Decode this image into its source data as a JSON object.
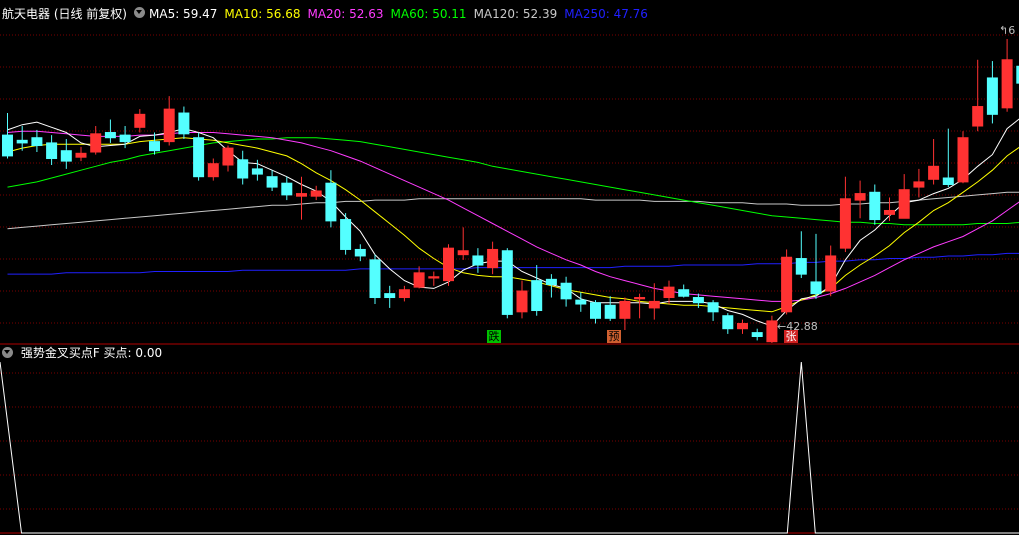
{
  "main_legend": {
    "title": "航天电器 (日线 前复权)",
    "ma5": "MA5: 59.47",
    "ma10": "MA10: 56.68",
    "ma20": "MA20: 52.63",
    "ma60": "MA60: 50.11",
    "ma120": "MA120: 52.39",
    "ma250": "MA250: 47.76"
  },
  "colors": {
    "bg": "#000000",
    "up": "#ff3232",
    "down": "#54ffff",
    "ma5": "#ffffff",
    "ma10": "#ffff00",
    "ma20": "#ff3cff",
    "ma60": "#00ff00",
    "ma120": "#c8c8c8",
    "ma250": "#2020ff",
    "grid": "#7a0000",
    "divider": "#b00000"
  },
  "sub_legend": {
    "title": "强势金叉买点F  买点: 0.00"
  },
  "signals": {
    "die": "跌",
    "yu": "预",
    "zhang": "张"
  },
  "price_labels": {
    "low": "42.88",
    "high_partial": "6"
  },
  "chart_data": {
    "type": "candlestick",
    "title": "航天电器 (日线 前复权)",
    "ylim": [
      40.8,
      67.2
    ],
    "low_marker": 42.88,
    "candles": [
      [
        56.8,
        55.2,
        58.5,
        55.0
      ],
      [
        56.4,
        56.2,
        57.5,
        55.6
      ],
      [
        56.6,
        56.0,
        57.2,
        55.5
      ],
      [
        56.2,
        55.0,
        56.8,
        54.5
      ],
      [
        55.6,
        54.8,
        56.5,
        54.2
      ],
      [
        55.1,
        55.4,
        55.9,
        54.8
      ],
      [
        55.5,
        56.9,
        57.5,
        55.3
      ],
      [
        57.0,
        56.6,
        58.0,
        56.2
      ],
      [
        56.8,
        56.3,
        57.5,
        55.8
      ],
      [
        57.4,
        58.4,
        58.8,
        57.0
      ],
      [
        56.3,
        55.6,
        57.0,
        55.3
      ],
      [
        56.3,
        58.8,
        59.8,
        56.0
      ],
      [
        58.5,
        56.9,
        59.0,
        56.5
      ],
      [
        56.6,
        53.6,
        57.0,
        53.3
      ],
      [
        53.6,
        54.6,
        55.0,
        53.3
      ],
      [
        54.5,
        55.8,
        56.0,
        54.0
      ],
      [
        54.9,
        53.5,
        55.6,
        53.0
      ],
      [
        54.2,
        53.8,
        54.9,
        53.3
      ],
      [
        53.6,
        52.8,
        54.1,
        52.5
      ],
      [
        53.1,
        52.2,
        53.6,
        51.8
      ],
      [
        52.1,
        52.3,
        53.6,
        50.3
      ],
      [
        52.1,
        52.5,
        52.9,
        51.8
      ],
      [
        53.1,
        50.2,
        54.1,
        49.7
      ],
      [
        50.3,
        48.0,
        50.8,
        47.6
      ],
      [
        48.0,
        47.5,
        48.4,
        47.1
      ],
      [
        47.2,
        44.3,
        47.6,
        43.8
      ],
      [
        44.6,
        44.3,
        45.2,
        43.5
      ],
      [
        44.3,
        44.9,
        45.2,
        44.0
      ],
      [
        45.1,
        46.2,
        46.7,
        45.0
      ],
      [
        45.8,
        45.9,
        46.3,
        45.2
      ],
      [
        45.6,
        48.1,
        48.4,
        45.2
      ],
      [
        47.6,
        47.9,
        49.7,
        47.2
      ],
      [
        47.5,
        46.8,
        48.1,
        46.2
      ],
      [
        46.6,
        48.0,
        48.6,
        46.1
      ],
      [
        47.9,
        43.0,
        48.1,
        42.7
      ],
      [
        43.2,
        44.8,
        45.6,
        42.7
      ],
      [
        45.6,
        43.3,
        46.8,
        42.9
      ],
      [
        45.7,
        45.3,
        46.1,
        44.3
      ],
      [
        45.4,
        44.2,
        45.9,
        43.6
      ],
      [
        44.1,
        43.8,
        44.7,
        43.2
      ],
      [
        43.9,
        42.7,
        44.1,
        42.3
      ],
      [
        43.7,
        42.7,
        44.4,
        42.5
      ],
      [
        42.7,
        44.0,
        44.3,
        41.8
      ],
      [
        44.2,
        44.3,
        44.6,
        42.7
      ],
      [
        43.5,
        44.0,
        45.4,
        42.6
      ],
      [
        44.3,
        45.1,
        45.6,
        43.8
      ],
      [
        44.9,
        44.4,
        45.3,
        44.3
      ],
      [
        44.3,
        43.9,
        44.6,
        43.5
      ],
      [
        43.9,
        43.2,
        44.1,
        42.5
      ],
      [
        42.9,
        41.9,
        43.1,
        41.5
      ],
      [
        41.9,
        42.3,
        42.6,
        41.5
      ],
      [
        41.6,
        41.3,
        41.9,
        41.0
      ],
      [
        40.9,
        42.5,
        42.9,
        40.8
      ],
      [
        43.2,
        47.4,
        48.0,
        43.0
      ],
      [
        47.3,
        46.1,
        49.4,
        45.8
      ],
      [
        45.5,
        44.6,
        49.2,
        44.2
      ],
      [
        44.8,
        47.5,
        48.3,
        44.4
      ],
      [
        48.1,
        51.9,
        53.6,
        47.8
      ],
      [
        51.8,
        52.3,
        53.3,
        50.4
      ],
      [
        52.4,
        50.3,
        53.0,
        49.9
      ],
      [
        50.7,
        51.0,
        52.0,
        50.2
      ],
      [
        50.4,
        52.6,
        53.8,
        50.4
      ],
      [
        52.8,
        53.2,
        54.2,
        52.0
      ],
      [
        53.4,
        54.4,
        56.5,
        53.0
      ],
      [
        53.5,
        53.0,
        57.3,
        52.8
      ],
      [
        53.2,
        56.6,
        57.1,
        53.1
      ],
      [
        57.5,
        59.0,
        62.6,
        57.1
      ],
      [
        61.2,
        58.4,
        62.5,
        57.7
      ],
      [
        58.9,
        62.6,
        64.2,
        58.6
      ],
      [
        62.1,
        60.8,
        64.0,
        60.4
      ],
      [
        61.4,
        62.6,
        63.6,
        57.9
      ]
    ],
    "ma5": [
      57.2,
      57.6,
      57.8,
      57.4,
      57.0,
      56.2,
      55.9,
      56.0,
      56.1,
      56.7,
      56.8,
      57.0,
      57.3,
      57.0,
      56.6,
      55.6,
      54.7,
      54.6,
      54.1,
      53.6,
      53.0,
      52.5,
      51.7,
      50.5,
      49.4,
      47.6,
      46.5,
      45.6,
      45.1,
      45.0,
      45.5,
      46.4,
      46.9,
      47.1,
      47.1,
      46.3,
      45.8,
      45.3,
      45.0,
      44.2,
      43.9,
      43.9,
      43.9,
      43.9,
      43.8,
      44.0,
      44.0,
      44.0,
      43.8,
      43.3,
      43.0,
      42.5,
      42.1,
      43.3,
      44.2,
      44.4,
      45.2,
      47.2,
      48.7,
      49.5,
      50.6,
      51.6,
      51.8,
      52.3,
      52.7,
      53.4,
      54.4,
      55.3,
      57.3,
      58.2,
      59.5
    ],
    "ma10": [
      55.5,
      55.8,
      56.0,
      56.1,
      56.1,
      56.1,
      56.1,
      56.1,
      56.1,
      56.3,
      56.4,
      56.5,
      56.6,
      56.5,
      56.4,
      56.2,
      56.0,
      55.8,
      55.5,
      55.2,
      54.6,
      53.9,
      53.3,
      52.6,
      51.8,
      50.9,
      50.0,
      49.1,
      48.1,
      47.3,
      46.6,
      46.2,
      46.0,
      45.9,
      45.9,
      45.7,
      45.5,
      45.2,
      44.9,
      44.7,
      44.5,
      44.3,
      44.2,
      44.0,
      43.9,
      43.8,
      43.7,
      43.7,
      43.6,
      43.5,
      43.4,
      43.3,
      43.2,
      43.6,
      44.1,
      44.5,
      45.0,
      46.0,
      46.8,
      47.5,
      48.3,
      49.3,
      50.1,
      51.0,
      51.6,
      52.4,
      53.2,
      54.1,
      55.2,
      56.0,
      56.7
    ],
    "ma20": [
      57.0,
      57.1,
      57.1,
      57.0,
      56.9,
      56.8,
      56.7,
      56.7,
      56.7,
      56.8,
      56.8,
      56.9,
      57.0,
      57.0,
      57.0,
      56.9,
      56.8,
      56.7,
      56.6,
      56.4,
      56.2,
      55.9,
      55.6,
      55.2,
      54.8,
      54.3,
      53.8,
      53.3,
      52.8,
      52.3,
      51.8,
      51.2,
      50.6,
      50.0,
      49.4,
      48.8,
      48.2,
      47.7,
      47.2,
      46.8,
      46.3,
      45.9,
      45.6,
      45.3,
      45.0,
      44.8,
      44.6,
      44.5,
      44.4,
      44.3,
      44.2,
      44.1,
      44.0,
      44.0,
      44.1,
      44.3,
      44.6,
      45.0,
      45.5,
      46.0,
      46.6,
      47.2,
      47.7,
      48.2,
      48.6,
      49.0,
      49.6,
      50.2,
      51.0,
      51.8,
      52.6
    ],
    "ma60": [
      52.8,
      53.0,
      53.2,
      53.5,
      53.8,
      54.1,
      54.4,
      54.7,
      54.9,
      55.2,
      55.4,
      55.6,
      55.8,
      56.0,
      56.2,
      56.3,
      56.4,
      56.5,
      56.5,
      56.6,
      56.6,
      56.6,
      56.5,
      56.4,
      56.3,
      56.1,
      55.9,
      55.7,
      55.5,
      55.3,
      55.1,
      54.9,
      54.7,
      54.4,
      54.2,
      54.0,
      53.8,
      53.6,
      53.4,
      53.2,
      53.0,
      52.8,
      52.6,
      52.4,
      52.2,
      52.0,
      51.8,
      51.6,
      51.4,
      51.2,
      51.0,
      50.8,
      50.6,
      50.5,
      50.4,
      50.3,
      50.2,
      50.1,
      50.1,
      50.0,
      50.0,
      49.9,
      49.9,
      49.9,
      49.9,
      49.9,
      50.0,
      50.0,
      50.0,
      50.1,
      50.1
    ],
    "ma120": [
      49.6,
      49.7,
      49.8,
      49.9,
      50.0,
      50.1,
      50.2,
      50.3,
      50.4,
      50.5,
      50.6,
      50.7,
      50.8,
      50.9,
      51.0,
      51.1,
      51.2,
      51.3,
      51.4,
      51.4,
      51.5,
      51.6,
      51.6,
      51.7,
      51.7,
      51.8,
      51.8,
      51.8,
      51.9,
      51.9,
      51.9,
      51.9,
      51.9,
      51.9,
      51.9,
      51.9,
      51.9,
      51.9,
      51.9,
      51.9,
      51.8,
      51.8,
      51.8,
      51.8,
      51.7,
      51.7,
      51.7,
      51.7,
      51.6,
      51.6,
      51.6,
      51.5,
      51.5,
      51.5,
      51.4,
      51.4,
      51.4,
      51.5,
      51.5,
      51.6,
      51.6,
      51.7,
      51.8,
      51.9,
      52.0,
      52.1,
      52.2,
      52.3,
      52.4,
      52.4,
      52.4
    ],
    "ma250": [
      46.1,
      46.1,
      46.1,
      46.1,
      46.2,
      46.2,
      46.2,
      46.2,
      46.2,
      46.2,
      46.3,
      46.3,
      46.3,
      46.3,
      46.3,
      46.3,
      46.4,
      46.4,
      46.4,
      46.4,
      46.4,
      46.4,
      46.4,
      46.4,
      46.5,
      46.5,
      46.5,
      46.5,
      46.5,
      46.5,
      46.5,
      46.5,
      46.6,
      46.6,
      46.6,
      46.6,
      46.6,
      46.6,
      46.6,
      46.6,
      46.6,
      46.6,
      46.7,
      46.7,
      46.7,
      46.7,
      46.8,
      46.8,
      46.8,
      46.8,
      46.8,
      46.9,
      46.9,
      46.9,
      47.0,
      47.0,
      47.1,
      47.1,
      47.2,
      47.2,
      47.3,
      47.3,
      47.4,
      47.4,
      47.5,
      47.5,
      47.6,
      47.6,
      47.7,
      47.7,
      47.8
    ],
    "signal_bars": [
      {
        "label": "跌",
        "index": 34
      },
      {
        "label": "预",
        "index": 42
      },
      {
        "label": "张",
        "index": 54
      }
    ],
    "sub_indicator": {
      "name": "强势金叉买点F",
      "value": 0.0,
      "spikes": [
        0,
        54
      ],
      "ylim": [
        0,
        1
      ]
    }
  }
}
